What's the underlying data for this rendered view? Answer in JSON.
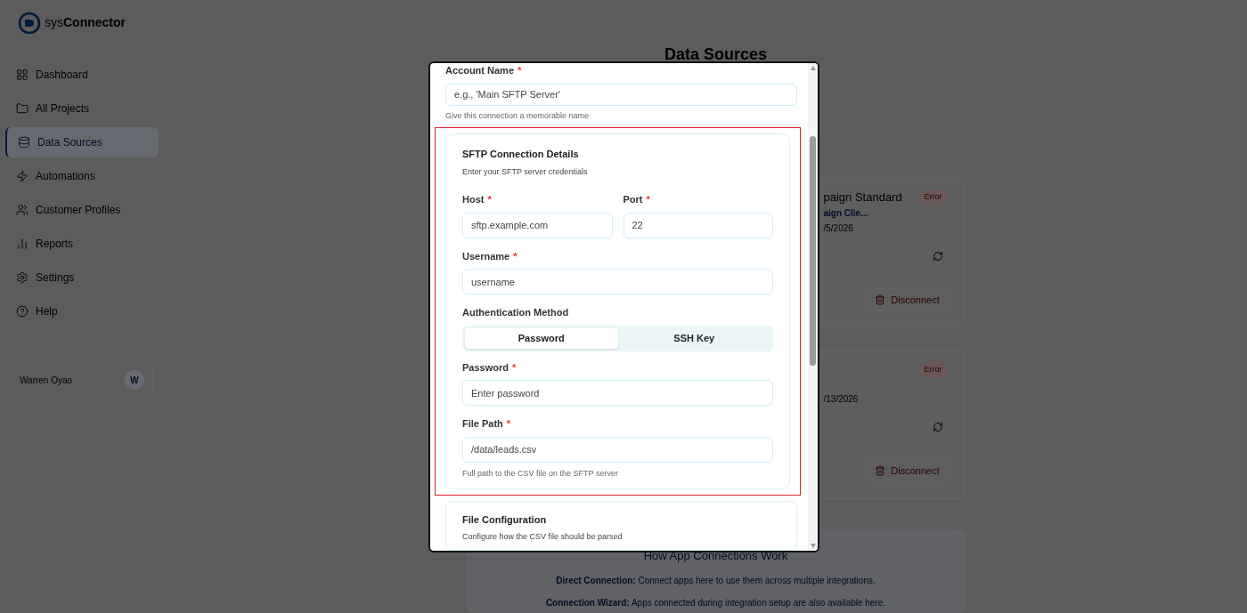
{
  "brand": {
    "prefix": "sys",
    "name": "Connector"
  },
  "sidebar": {
    "items": [
      {
        "label": "Dashboard",
        "selected": false
      },
      {
        "label": "All Projects",
        "selected": false
      },
      {
        "label": "Data Sources",
        "selected": true
      },
      {
        "label": "Automations",
        "selected": false
      },
      {
        "label": "Customer Profiles",
        "selected": false
      },
      {
        "label": "Reports",
        "selected": false
      },
      {
        "label": "Settings",
        "selected": false
      },
      {
        "label": "Help",
        "selected": false
      }
    ],
    "user": {
      "name": "Warren Oyao",
      "initial": "W"
    }
  },
  "page": {
    "title": "Data Sources"
  },
  "cards": [
    {
      "title": "paign Standard",
      "subtitle": "aign Clie...",
      "date": "/5/2026",
      "status": "Error",
      "action": "Disconnect"
    },
    {
      "date": "/13/2026",
      "status": "Error",
      "action": "Disconnect"
    }
  ],
  "info": {
    "title": "How App Connections Work",
    "lines": [
      "**Direct Connection:** Connect apps here to use them across multiple integrations.",
      "**Connection Wizard:** Apps connected during integration setup are also available here."
    ]
  },
  "dialog": {
    "account": {
      "label": "Account Name",
      "mark": "*",
      "placeholder": "e.g., 'Main SFTP Server'",
      "hint": "Give this connection a memorable name"
    },
    "sftp": {
      "title": "SFTP Connection Details",
      "subtitle": "Enter your SFTP server credentials",
      "host": {
        "label": "Host",
        "mark": "*",
        "placeholder": "sftp.example.com"
      },
      "port": {
        "label": "Port",
        "mark": "*",
        "placeholder": "22"
      },
      "username": {
        "label": "Username",
        "mark": "*",
        "placeholder": "username"
      },
      "auth": {
        "label": "Authentication Method",
        "tabs": [
          {
            "label": "Password",
            "selected": true
          },
          {
            "label": "SSH Key",
            "selected": false
          }
        ]
      },
      "password": {
        "label": "Password",
        "mark": "*",
        "placeholder": "Enter password"
      },
      "path": {
        "label": "File Path",
        "mark": "*",
        "placeholder": "/data/leads.csv",
        "hint": "Full path to the CSV file on the SFTP server"
      }
    },
    "file_config": {
      "title": "File Configuration",
      "subtitle": "Configure how the CSV file should be parsed"
    }
  }
}
